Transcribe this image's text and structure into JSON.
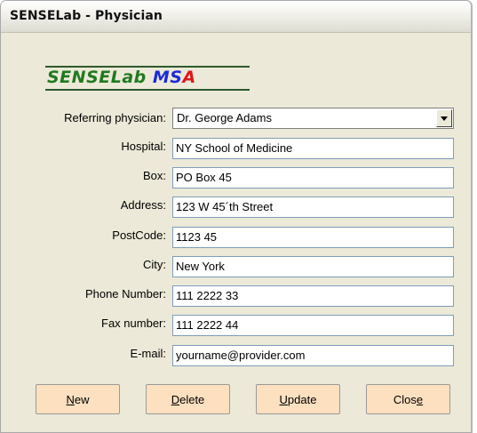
{
  "window": {
    "title": "SENSELab - Physician"
  },
  "logo": {
    "part1": "SENSELab ",
    "part2": "MS",
    "part3": "A"
  },
  "form": {
    "referring_physician": {
      "label": "Referring physician:",
      "value": "Dr. George Adams"
    },
    "hospital": {
      "label": "Hospital:",
      "value": "NY School of Medicine"
    },
    "box": {
      "label": "Box:",
      "value": "PO Box 45"
    },
    "address": {
      "label": "Address:",
      "value": "123 W 45´th Street"
    },
    "postcode": {
      "label": "PostCode:",
      "value": "1123 45"
    },
    "city": {
      "label": "City:",
      "value": "New York"
    },
    "phone": {
      "label": "Phone Number:",
      "value": "111 2222 33"
    },
    "fax": {
      "label": "Fax number:",
      "value": "111 2222 44"
    },
    "email": {
      "label": "E-mail:",
      "value": "yourname@provider.com"
    }
  },
  "buttons": {
    "new": {
      "mn": "N",
      "rest": "ew"
    },
    "delete": {
      "mn": "D",
      "rest": "elete"
    },
    "update": {
      "mn": "U",
      "rest": "pdate"
    },
    "close": {
      "pre": "Clos",
      "mn": "e"
    }
  },
  "colors": {
    "button_bg": "#fde0bf",
    "logo_green": "#1f7a1f",
    "logo_blue": "#1d2ad8",
    "logo_red": "#e01818"
  }
}
